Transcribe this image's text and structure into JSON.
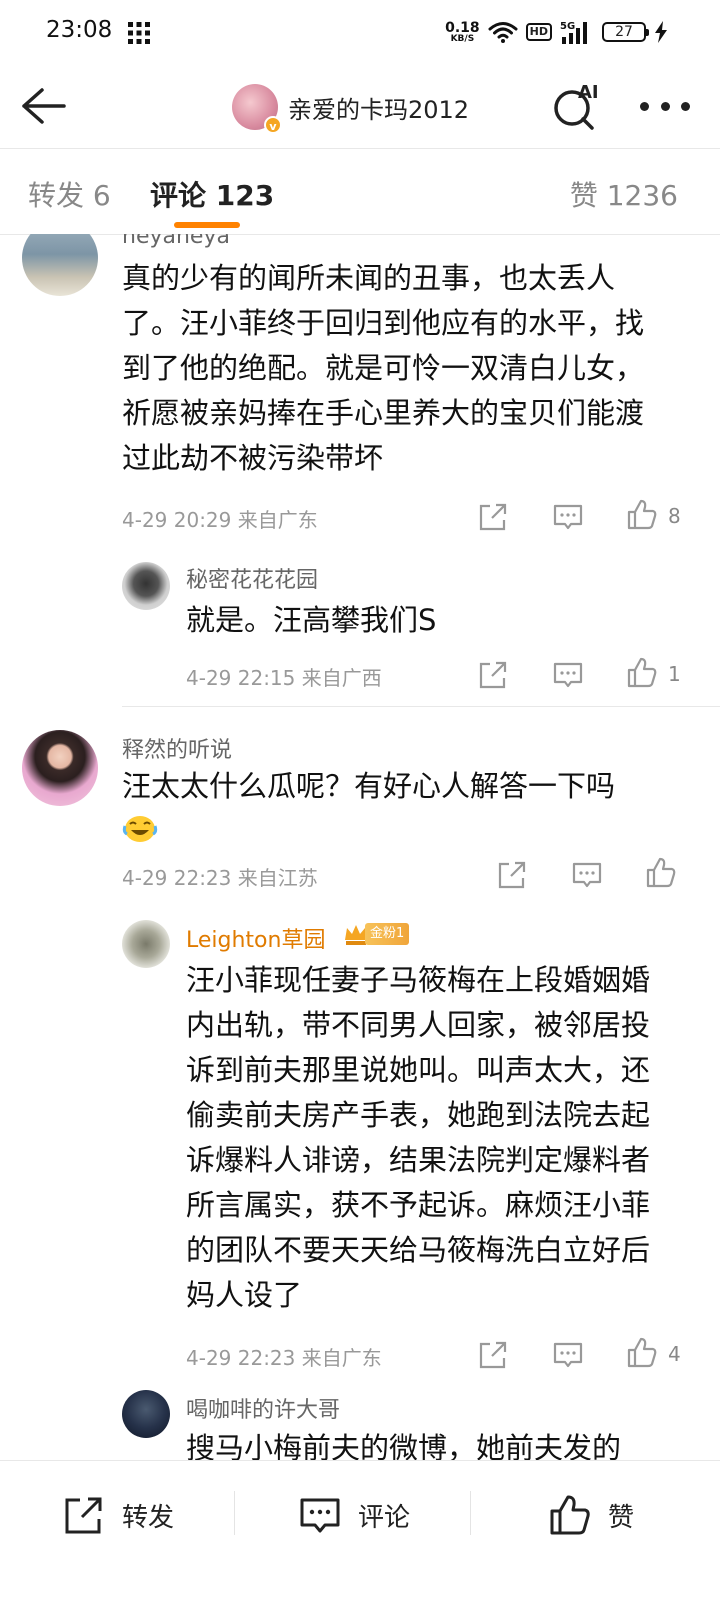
{
  "status_bar": {
    "time": "23:08",
    "net_speed_value": "0.18",
    "net_speed_unit": "KB/S",
    "hd": "HD",
    "network": "5G",
    "battery": "27"
  },
  "header": {
    "title": "亲爱的卡玛2012",
    "verified_badge": "v",
    "search_ai_label": "AI"
  },
  "tabs": {
    "repost": "转发 6",
    "comments": "评论 123",
    "likes": "赞 1236",
    "active_color": "#ff8200"
  },
  "comments": [
    {
      "user": "neyaneya",
      "text": "真的少有的闻所未闻的丑事，也太丢人了。汪小菲终于回归到他应有的水平，找到了他的绝配。就是可怜一双清白儿女，祈愿被亲妈捧在手心里养大的宝贝们能渡过此劫不被污染带坏",
      "meta": "4-29 20:29  来自广东",
      "likes": "8",
      "replies": [
        {
          "user": "秘密花花花园",
          "text": "就是。汪高攀我们S",
          "meta": "4-29 22:15  来自广西",
          "likes": "1"
        }
      ]
    },
    {
      "user": "释然的听说",
      "text": "汪太太什么瓜呢？有好心人解答一下吗",
      "meta": "4-29 22:23  来自江苏",
      "likes": "",
      "replies": [
        {
          "user": "Leighton草园",
          "badge": "金粉1",
          "text": "汪小菲现任妻子马筱梅在上段婚姻婚内出轨，带不同男人回家，被邻居投诉到前夫那里说她叫。叫声太大，还偷卖前夫房产手表，她跑到法院去起诉爆料人诽谤，结果法院判定爆料者所言属实，获不予起诉。麻烦汪小菲的团队不要天天给马筱梅洗白立好后妈人设了",
          "meta": "4-29 22:23  来自广东",
          "likes": "4"
        },
        {
          "user": "喝咖啡的许大哥",
          "text": "搜马小梅前夫的微博，她前夫发的"
        }
      ]
    }
  ],
  "bottom_bar": {
    "repost": "转发",
    "comment": "评论",
    "like": "赞"
  }
}
